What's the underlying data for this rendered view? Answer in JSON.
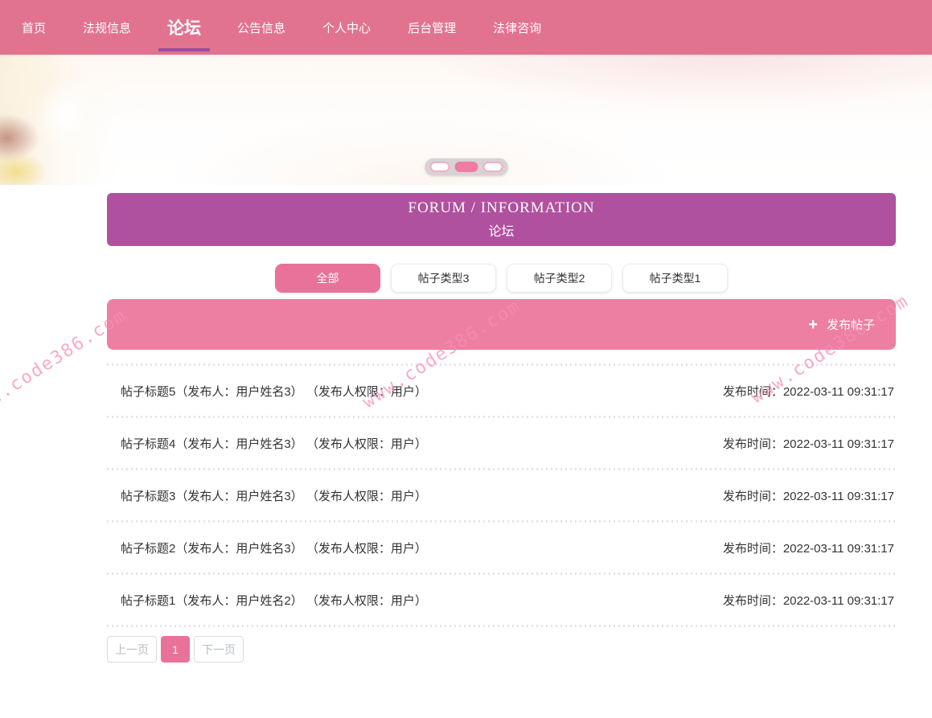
{
  "nav": {
    "items": [
      {
        "label": "首页",
        "active": false
      },
      {
        "label": "法规信息",
        "active": false
      },
      {
        "label": "论坛",
        "active": true
      },
      {
        "label": "公告信息",
        "active": false
      },
      {
        "label": "个人中心",
        "active": false
      },
      {
        "label": "后台管理",
        "active": false
      },
      {
        "label": "法律咨询",
        "active": false
      }
    ]
  },
  "hero": {
    "carousel": {
      "dot_count": 3,
      "active_index": 1
    }
  },
  "forum": {
    "header": {
      "title_en": "FORUM / INFORMATION",
      "title_zh": "论坛"
    },
    "filters": [
      {
        "label": "全部",
        "active": true
      },
      {
        "label": "帖子类型3",
        "active": false
      },
      {
        "label": "帖子类型2",
        "active": false
      },
      {
        "label": "帖子类型1",
        "active": false
      }
    ],
    "publish_button": {
      "label": "发布帖子",
      "icon_glyph": "+"
    },
    "posts": [
      {
        "title": "帖子标题5（发布人：用户姓名3） （发布人权限：用户）",
        "time": "发布时间：2022-03-11 09:31:17"
      },
      {
        "title": "帖子标题4（发布人：用户姓名3） （发布人权限：用户）",
        "time": "发布时间：2022-03-11 09:31:17"
      },
      {
        "title": "帖子标题3（发布人：用户姓名3） （发布人权限：用户）",
        "time": "发布时间：2022-03-11 09:31:17"
      },
      {
        "title": "帖子标题2（发布人：用户姓名3） （发布人权限：用户）",
        "time": "发布时间：2022-03-11 09:31:17"
      },
      {
        "title": "帖子标题1（发布人：用户姓名2） （发布人权限：用户）",
        "time": "发布时间：2022-03-11 09:31:17"
      }
    ],
    "pagination": {
      "prev": "上一页",
      "current": "1",
      "next": "下一页"
    }
  },
  "watermark": {
    "text": "www.code386.com"
  },
  "colors": {
    "nav_pink": "#e2738f",
    "header_purple": "#b0519f",
    "accent_pink": "#e8729a",
    "publish_bar_pink": "#ec7fa2",
    "active_tab_underline": "#a14ba0",
    "watermark_pink": "#f78cb4"
  }
}
